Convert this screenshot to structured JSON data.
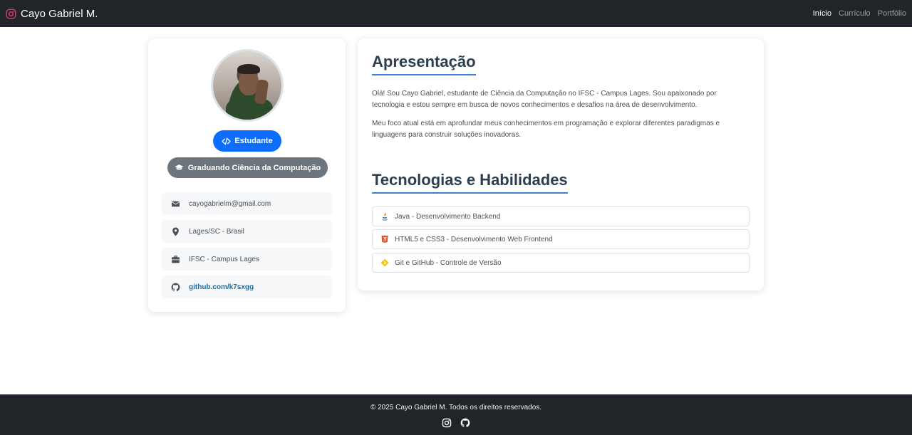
{
  "navbar": {
    "brand": "Cayo Gabriel M.",
    "brand_icon": "instagram-icon",
    "links": [
      {
        "label": "Início",
        "active": true
      },
      {
        "label": "Currículo",
        "active": false
      },
      {
        "label": "Portfólio",
        "active": false
      }
    ]
  },
  "profile": {
    "role_badge": "Estudante",
    "course_badge": "Graduando Ciência da Computação",
    "info": [
      {
        "icon": "envelope-icon",
        "text": "cayogabrielm@gmail.com"
      },
      {
        "icon": "map-pin-icon",
        "text": "Lages/SC - Brasil"
      },
      {
        "icon": "briefcase-icon",
        "text": "IFSC - Campus Lages"
      },
      {
        "icon": "github-icon",
        "text": "github.com/k7sxgg"
      }
    ]
  },
  "main": {
    "about_title": "Apresentação",
    "about_p1": "Olá! Sou Cayo Gabriel, estudante de Ciência da Computação no IFSC - Campus Lages. Sou apaixonado por tecnologia e estou sempre em busca de novos conhecimentos e desafios na área de desenvolvimento.",
    "about_p2": "Meu foco atual está em aprofundar meus conhecimentos em programação e explorar diferentes paradigmas e linguagens para construir soluções inovadoras.",
    "skills_title": "Tecnologias e Habilidades",
    "skills": [
      {
        "icon": "java-icon",
        "text": "Java - Desenvolvimento Backend"
      },
      {
        "icon": "html5-icon",
        "text": "HTML5 e CSS3 - Desenvolvimento Web Frontend"
      },
      {
        "icon": "git-icon",
        "text": "Git e GitHub - Controle de Versão"
      }
    ]
  },
  "footer": {
    "copyright": "© 2025 Cayo Gabriel M. Todos os direitos reservados."
  },
  "colors": {
    "navbar_bg": "#212529",
    "primary": "#0d6efd",
    "secondary": "#6c757d",
    "title": "#2c3e50",
    "accent_underline": "#3f7fd0"
  }
}
